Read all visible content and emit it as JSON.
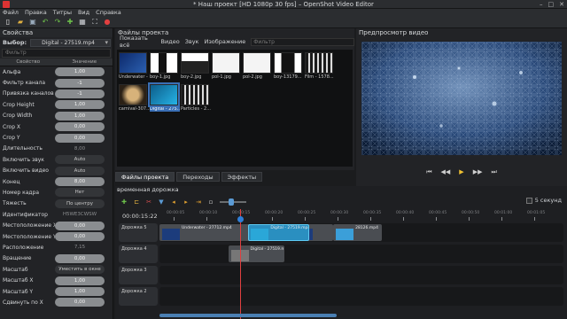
{
  "window": {
    "title": "* Наш проект [HD 1080p 30 fps] – OpenShot Video Editor"
  },
  "menu": [
    "Файл",
    "Правка",
    "Титры",
    "Вид",
    "Справка"
  ],
  "properties": {
    "panel_title": "Свойства",
    "selection_label": "Выбор:",
    "selection_value": "Digital - 27519.mp4",
    "filter_placeholder": "Фильтр",
    "col_property": "Свойство",
    "col_value": "Значение",
    "rows": [
      {
        "name": "Альфа",
        "value": "1,00",
        "style": "bar"
      },
      {
        "name": "Фильтр канала",
        "value": "-1",
        "style": "bar"
      },
      {
        "name": "Привязка каналов",
        "value": "-1",
        "style": "bar"
      },
      {
        "name": "Crop Height",
        "value": "1,00",
        "style": "bar"
      },
      {
        "name": "Crop Width",
        "value": "1,00",
        "style": "bar"
      },
      {
        "name": "Crop X",
        "value": "0,00",
        "style": "bar"
      },
      {
        "name": "Crop Y",
        "value": "0,00",
        "style": "bar"
      },
      {
        "name": "Длительность",
        "value": "8,00",
        "style": "flat"
      },
      {
        "name": "Включить звук",
        "value": "Auto",
        "style": "dark"
      },
      {
        "name": "Включить видео",
        "value": "Auto",
        "style": "dark"
      },
      {
        "name": "Конец",
        "value": "8,00",
        "style": "bar"
      },
      {
        "name": "Номер кадра",
        "value": "Нет",
        "style": "dark"
      },
      {
        "name": "Тяжесть",
        "value": "По центру",
        "style": "dark"
      },
      {
        "name": "Идентификатор",
        "value": "H5WE3CWSW",
        "style": "flat"
      },
      {
        "name": "Местоположение X",
        "value": "0,00",
        "style": "bar"
      },
      {
        "name": "Местоположение Y",
        "value": "0,00",
        "style": "bar"
      },
      {
        "name": "Расположение",
        "value": "7,15",
        "style": "flat"
      },
      {
        "name": "Вращение",
        "value": "0,00",
        "style": "bar"
      },
      {
        "name": "Масштаб",
        "value": "Уместить в окне",
        "style": "dark"
      },
      {
        "name": "Масштаб X",
        "value": "1,00",
        "style": "bar"
      },
      {
        "name": "Масштаб Y",
        "value": "1,00",
        "style": "bar"
      },
      {
        "name": "Сдвинуть по X",
        "value": "0,00",
        "style": "bar"
      }
    ]
  },
  "files": {
    "panel_title": "Файлы проекта",
    "tabs": [
      "Показать всё",
      "Видео",
      "Звук",
      "Изображение"
    ],
    "filter_placeholder": "Фильтр",
    "items": [
      {
        "caption": "Underwater - ...",
        "kind": "blue"
      },
      {
        "caption": "boy-1.jpg",
        "kind": "bw1"
      },
      {
        "caption": "boy-2.jpg",
        "kind": "bw2"
      },
      {
        "caption": "pol-1.jpg",
        "kind": "white"
      },
      {
        "caption": "pol-2.jpg",
        "kind": "white"
      },
      {
        "caption": "boy-13179...",
        "kind": "bw3"
      },
      {
        "caption": "Film - 1578...",
        "kind": "film"
      },
      {
        "caption": "carnival-307...",
        "kind": "mask"
      },
      {
        "caption": "Digital - 275...",
        "kind": "cyan",
        "selected": true
      },
      {
        "caption": "Particles - 2...",
        "kind": "film"
      }
    ]
  },
  "preview": {
    "panel_title": "Предпросмотр видео"
  },
  "bottom_tabs": [
    "Файлы проекта",
    "Переходы",
    "Эффекты"
  ],
  "timeline": {
    "panel_title": "временная дорожка",
    "seconds_label": "5 секунд",
    "timecode": "00:00:15:22",
    "ruler_labels": [
      "00:00:05",
      "00:00:10",
      "00:00:15",
      "00:00:20",
      "00:00:25",
      "00:00:30",
      "00:00:35",
      "00:00:40",
      "00:00:45",
      "00:00:50",
      "00:01:00",
      "00:01:05"
    ],
    "tracks": [
      {
        "name": "Дорожка 5",
        "clips": [
          {
            "label": "Underwater - 27712.mp4",
            "start": 0.0,
            "end": 0.33,
            "color": "#4a4d52",
            "thumb": "#1c3c7c"
          },
          {
            "label": "Digital - 27519.mp4",
            "start": 0.22,
            "end": 0.37,
            "color": "#2a8fc0",
            "thumb": "#2aa7d8",
            "overlay": true
          },
          {
            "label": "",
            "start": 0.33,
            "end": 0.43,
            "color": "#4a4d52",
            "thumb": "#1c3c7c"
          },
          {
            "label": "28126.mp4",
            "start": 0.43,
            "end": 0.55,
            "color": "#4a4d52",
            "thumb": "#3b9fd9"
          }
        ]
      },
      {
        "name": "Дорожка 4",
        "clips": [
          {
            "label": "Digital - 27519.mp4",
            "start": 0.17,
            "end": 0.31,
            "color": "#4a4d52",
            "thumb": "#777"
          }
        ]
      },
      {
        "name": "Дорожка 3",
        "clips": []
      },
      {
        "name": "Дорожка 2",
        "clips": []
      }
    ]
  }
}
